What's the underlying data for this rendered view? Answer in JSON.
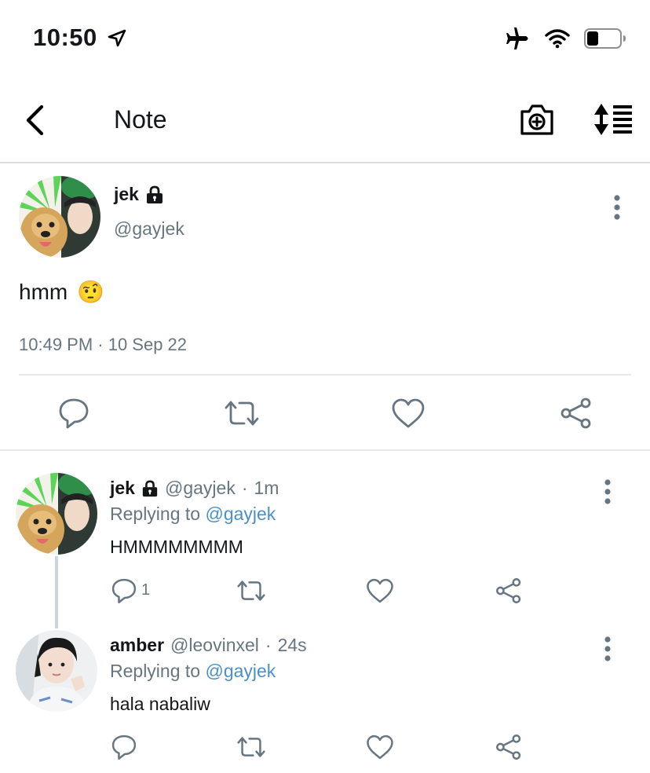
{
  "status_bar": {
    "time": "10:50"
  },
  "nav": {
    "title": "Note"
  },
  "main_tweet": {
    "name": "jek",
    "handle": "@gayjek",
    "text": "hmm",
    "emoji": "🤨",
    "timestamp": "10:49 PM · 10 Sep 22"
  },
  "replies": [
    {
      "name": "jek",
      "handle": "@gayjek",
      "age": "1m",
      "replying_label": "Replying to",
      "replying_to": "@gayjek",
      "text": "HMMMMMMMM",
      "reply_count": "1"
    },
    {
      "name": "amber",
      "handle": "@leovinxel",
      "age": "24s",
      "replying_label": "Replying to",
      "replying_to": "@gayjek",
      "text": "hala nabaliw"
    }
  ],
  "colors": {
    "link": "#4a90c8",
    "muted": "#66757f",
    "text": "#14171a",
    "divider": "#e6e9eb"
  },
  "icons": [
    "location-arrow-icon",
    "airplane-icon",
    "wifi-icon",
    "battery-icon",
    "back-chevron-icon",
    "camera-plus-icon",
    "sort-icon",
    "lock-icon",
    "more-dots-icon",
    "reply-icon",
    "retweet-icon",
    "like-icon",
    "share-icon"
  ]
}
